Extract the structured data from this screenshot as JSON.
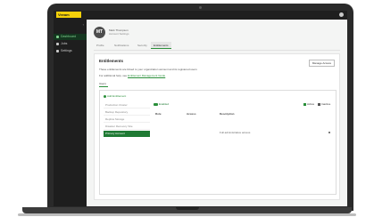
{
  "app": {
    "logo": "Veeam",
    "sidebar": {
      "collapse_icon": "chevron-left-icon",
      "items": [
        {
          "label": "Dashboard",
          "active": true
        },
        {
          "label": "Jobs",
          "active": false
        },
        {
          "label": "Settings",
          "active": false
        }
      ]
    }
  },
  "user": {
    "initials": "MT",
    "name": "Mark Thompson",
    "subtitle": "Account Settings"
  },
  "tabs": [
    {
      "label": "Profile",
      "active": false
    },
    {
      "label": "Notifications",
      "active": false
    },
    {
      "label": "Security",
      "active": false
    },
    {
      "label": "Entitlements",
      "active": true
    }
  ],
  "card": {
    "title": "Entitlements",
    "action_label": "Manage Access",
    "info_line_1": "These entitlements are linked to your organization account and its registered users",
    "info_line_2_prefix": "For additional help, see",
    "info_line_2_link": "Entitlement Management Guide",
    "section_label": "Users"
  },
  "panel": {
    "add_label": "Add Entitlement",
    "left_items": [
      {
        "label": "Production Cluster",
        "selected": false
      },
      {
        "label": "Backup Repository",
        "selected": false
      },
      {
        "label": "Replica Storage",
        "selected": false
      },
      {
        "label": "Disaster Recovery Site",
        "selected": false
      },
      {
        "label": "Primary Account",
        "selected": true
      }
    ],
    "active_pill": "Enabled",
    "legend": [
      {
        "label": "Active",
        "color": "#2a8f3a"
      },
      {
        "label": "Inactive",
        "color": "#555555"
      }
    ],
    "columns": [
      "Role",
      "Access",
      "Description"
    ],
    "rows": [
      {
        "description": "Full administrative access"
      }
    ]
  },
  "colors": {
    "accent": "#2a8f3a",
    "logo": "#f5d10a",
    "selected": "#1f7a34"
  }
}
